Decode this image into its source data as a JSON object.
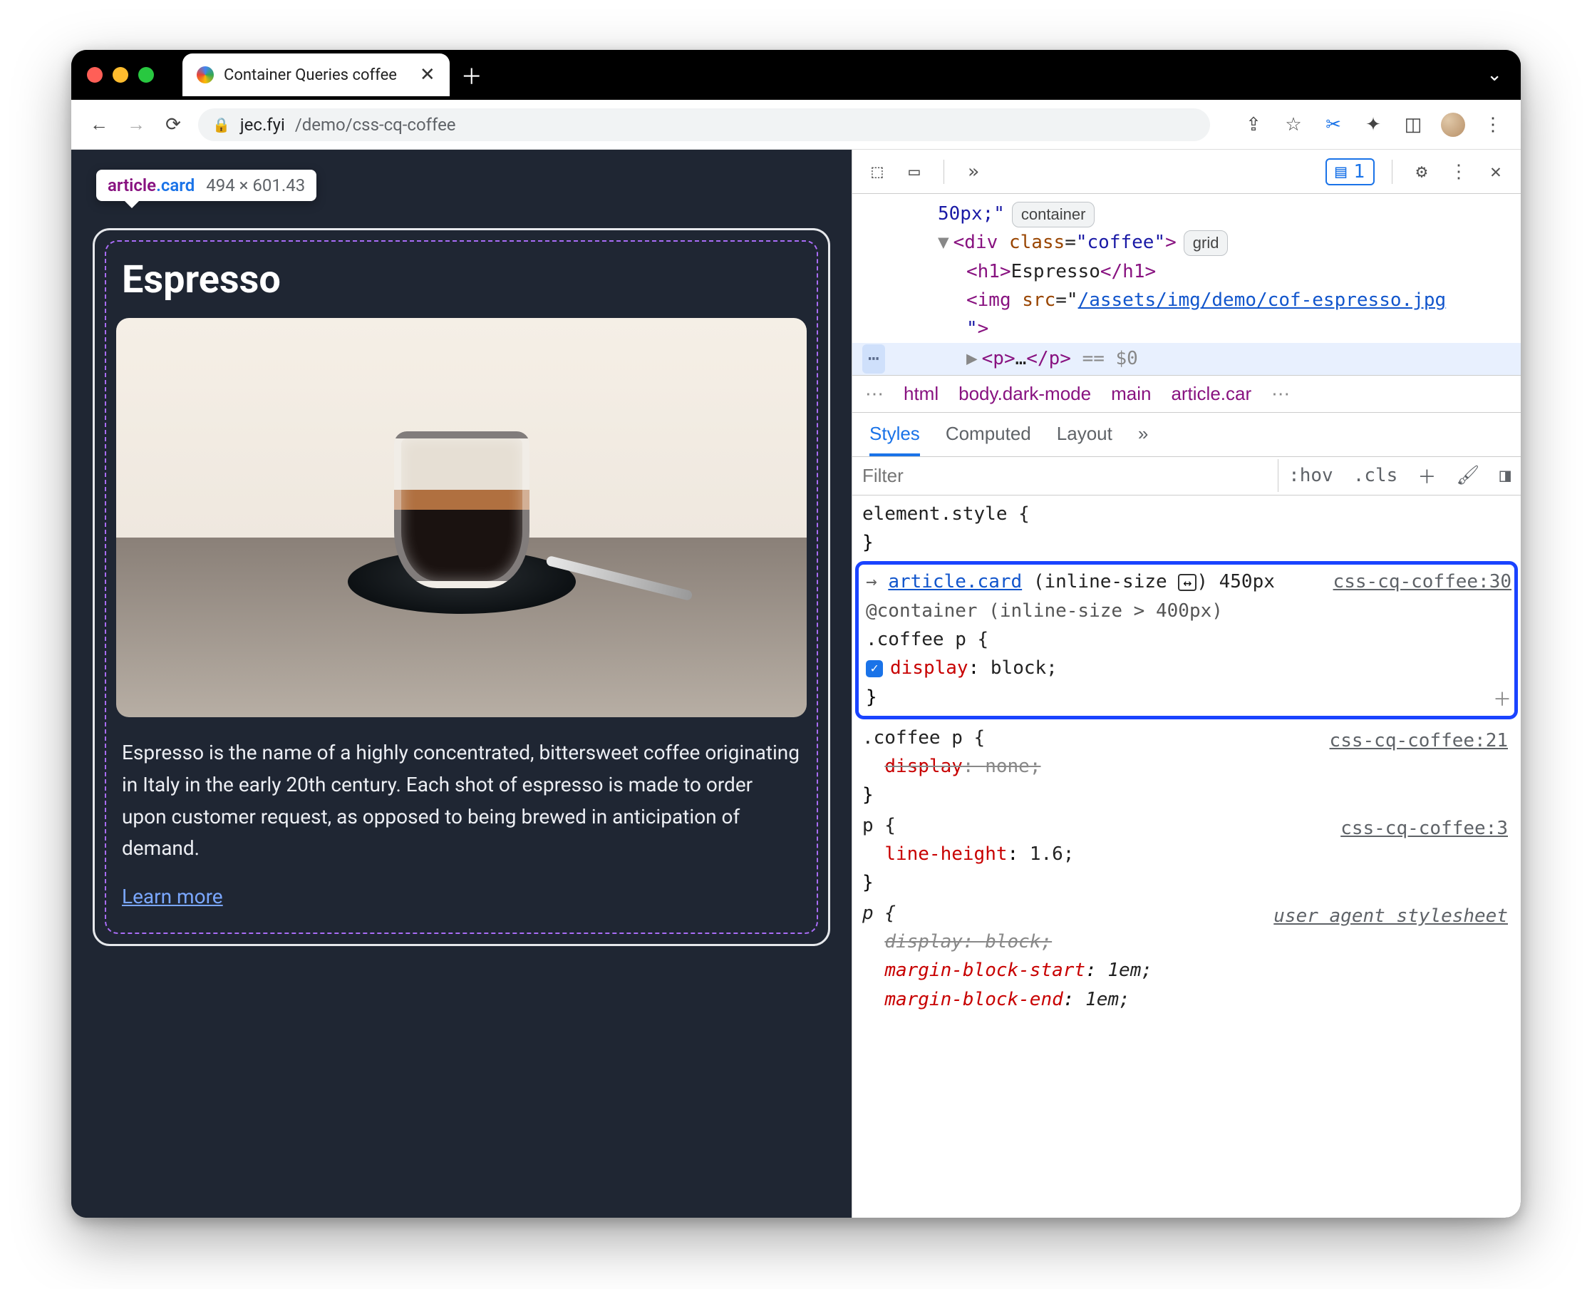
{
  "browser": {
    "tab_title": "Container Queries coffee",
    "url_domain": "jec.fyi",
    "url_path": "/demo/css-cq-coffee"
  },
  "inspect_tooltip": {
    "tag": "article",
    "cls": ".card",
    "dims": "494 × 601.43"
  },
  "page": {
    "heading": "Espresso",
    "paragraph": "Espresso is the name of a highly concentrated, bittersweet coffee originating in Italy in the early 20th century. Each shot of espresso is made to order upon customer request, as opposed to being brewed in anticipation of demand.",
    "learn_more": "Learn more"
  },
  "devtools": {
    "issues_count": "1",
    "elements": {
      "line1_width": "50px;\"",
      "line1_badge": "container",
      "div_open": "<div class=\"coffee\">",
      "div_badge": "grid",
      "h1": "<h1>Espresso</h1>",
      "img_prefix": "<img src=\"",
      "img_src": "/assets/img/demo/cof-espresso.jpg",
      "img_suffix": "\">",
      "p_sel": "<p>…</p>",
      "eq": "== $0"
    },
    "crumbs": [
      "html",
      "body.dark-mode",
      "main",
      "article.car"
    ],
    "tabs": [
      "Styles",
      "Computed",
      "Layout"
    ],
    "filter_placeholder": "Filter",
    "hov": ":hov",
    "cls": ".cls",
    "rules": {
      "element_style": "element.style {",
      "r1": {
        "container_sel": "article.card",
        "container_dim": "(inline-size",
        "container_val": ") 450px",
        "at": "@container (inline-size > 400px)",
        "selector": ".coffee p {",
        "src": "css-cq-coffee:30",
        "prop": "display",
        "val": "block;"
      },
      "r2": {
        "selector": ".coffee p {",
        "src": "css-cq-coffee:21",
        "prop": "display",
        "val": "none;"
      },
      "r3": {
        "selector": "p {",
        "src": "css-cq-coffee:3",
        "prop": "line-height",
        "val": "1.6;"
      },
      "r4": {
        "selector": "p {",
        "src": "user agent stylesheet",
        "p1": "display",
        "v1": "block;",
        "p2": "margin-block-start",
        "v2": "1em;",
        "p3": "margin-block-end",
        "v3": "1em;"
      }
    }
  }
}
